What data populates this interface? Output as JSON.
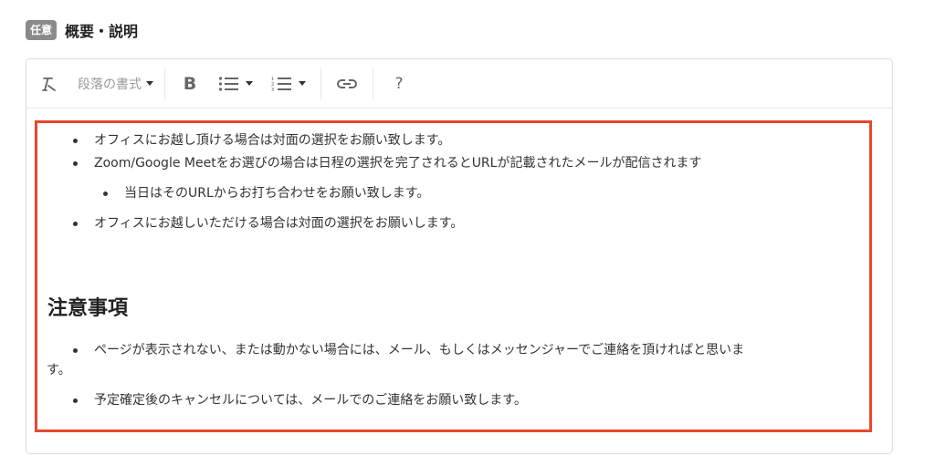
{
  "field": {
    "badge": "任意",
    "title": "概要・説明"
  },
  "toolbar": {
    "clear_format_icon": "remove-format-icon",
    "format_select_label": "段落の書式",
    "bold_label": "B",
    "help_label": "?"
  },
  "content": {
    "list1": [
      "オフィスにお越し頂ける場合は対面の選択をお願い致します。",
      "Zoom/Google Meetをお選びの場合は日程の選択を完了されるとURLが記載されたメールが配信されます"
    ],
    "nested": [
      "当日はそのURLからお打ち合わせをお願い致します。"
    ],
    "list1_after": [
      "オフィスにお越しいただける場合は対面の選択をお願いします。"
    ],
    "heading": "注意事項",
    "list2_item1_line1": "ページが表示されない、または動かない場合には、メール、もしくはメッセンジャーでご連絡を頂ければと思いま",
    "list2_item1_line2": "す。",
    "list2_item2": "予定確定後のキャンセルについては、メールでのご連絡をお願い致します。"
  },
  "colors": {
    "highlight_border": "#e8482e",
    "badge_bg": "#8a8a8a"
  }
}
